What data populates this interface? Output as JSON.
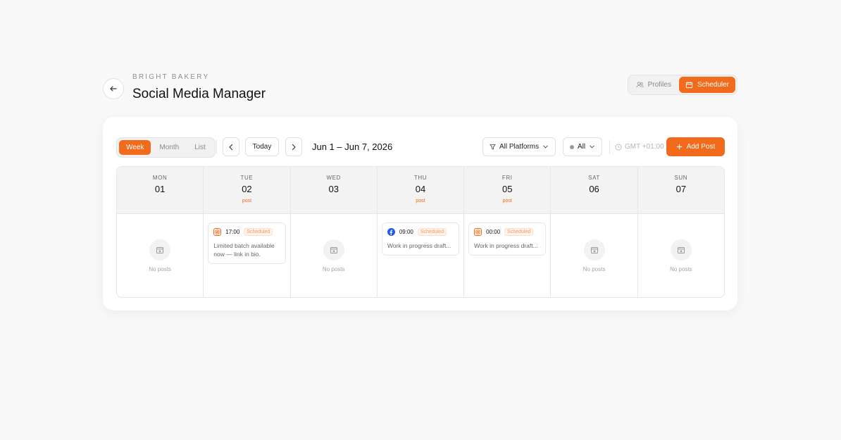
{
  "header": {
    "brand": "BRIGHT BAKERY",
    "title": "Social Media Manager",
    "views": [
      {
        "label": "Profiles",
        "icon": "users-icon",
        "active": false
      },
      {
        "label": "Scheduler",
        "icon": "calendar-icon",
        "active": true
      }
    ]
  },
  "toolbar": {
    "modes": [
      "Week",
      "Month",
      "List"
    ],
    "active_mode": "Week",
    "today_label": "Today",
    "range": "Jun 1 – Jun 7, 2026",
    "platform_filter": "All Platforms",
    "status_filter": "All",
    "timezone": "GMT +01:00",
    "add_label": "Add Post"
  },
  "empty_label": "No posts",
  "days": [
    {
      "dow": "MON",
      "num": "01",
      "tag": "",
      "posts": []
    },
    {
      "dow": "TUE",
      "num": "02",
      "tag": "post",
      "posts": [
        {
          "platform": "instagram",
          "time": "17:00",
          "status": "Scheduled",
          "text": "Limited batch available now — link in bio."
        }
      ]
    },
    {
      "dow": "WED",
      "num": "03",
      "tag": "",
      "posts": []
    },
    {
      "dow": "THU",
      "num": "04",
      "tag": "post",
      "posts": [
        {
          "platform": "facebook",
          "time": "09:00",
          "status": "Scheduled",
          "text": "Work in progress draft..."
        }
      ]
    },
    {
      "dow": "FRI",
      "num": "05",
      "tag": "post",
      "posts": [
        {
          "platform": "instagram",
          "time": "00:00",
          "status": "Scheduled",
          "text": "Work in progress draft..."
        }
      ]
    },
    {
      "dow": "SAT",
      "num": "06",
      "tag": "",
      "posts": []
    },
    {
      "dow": "SUN",
      "num": "07",
      "tag": "",
      "posts": []
    }
  ],
  "colors": {
    "accent": "#f26a1b",
    "facebook": "#1f5ee6"
  }
}
